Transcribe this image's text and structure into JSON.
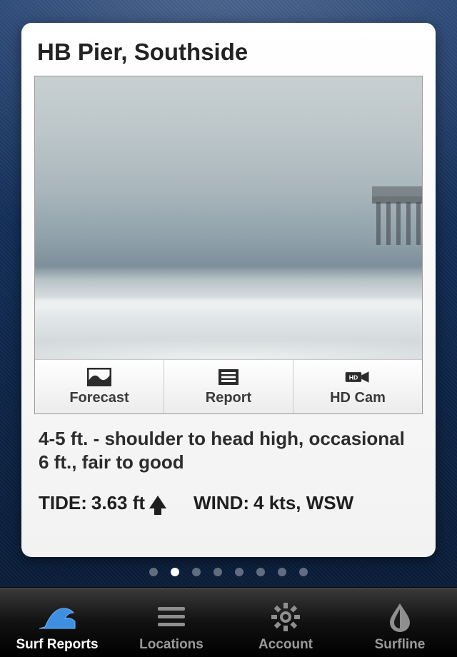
{
  "spot": {
    "title": "HB Pier, Southside",
    "summary": "4-5 ft. - shoulder to head high, occasional 6 ft., fair to good",
    "tide": {
      "label": "TIDE:",
      "value": "3.63 ft",
      "direction": "rising"
    },
    "wind": {
      "label": "WIND:",
      "value": "4 kts, WSW"
    }
  },
  "actions": {
    "forecast": "Forecast",
    "report": "Report",
    "hdcam": "HD Cam"
  },
  "pager": {
    "count": 8,
    "active": 1
  },
  "tabs": {
    "surf_reports": "Surf Reports",
    "locations": "Locations",
    "account": "Account",
    "surfline": "Surfline"
  }
}
